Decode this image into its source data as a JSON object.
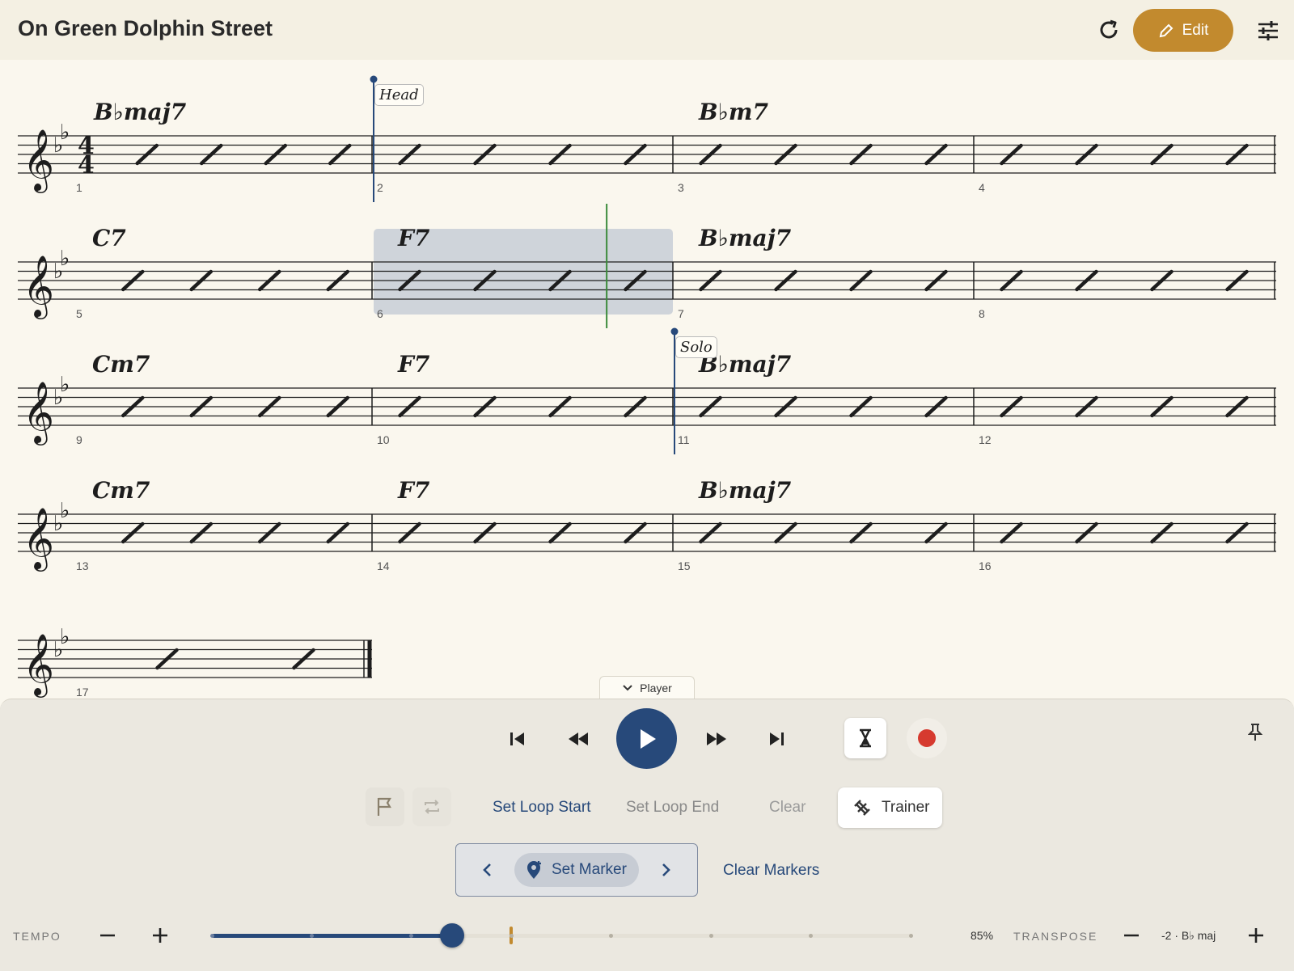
{
  "header": {
    "title": "On Green Dolphin Street",
    "edit_label": "Edit",
    "icons": [
      "refresh-icon",
      "pencil-icon",
      "sliders-icon"
    ]
  },
  "score": {
    "time_signature": "4/4",
    "key": "Bb major",
    "rows": [
      {
        "measures": [
          {
            "number": "1",
            "chord": "Bbmaj7",
            "beats": 4
          },
          {
            "number": "2",
            "chord": "",
            "beats": 4,
            "marker": "Head"
          },
          {
            "number": "3",
            "chord": "Bbm7",
            "beats": 4
          },
          {
            "number": "4",
            "chord": "",
            "beats": 4
          }
        ]
      },
      {
        "measures": [
          {
            "number": "5",
            "chord": "C7",
            "beats": 4
          },
          {
            "number": "6",
            "chord": "F7",
            "beats": 4,
            "loop": true
          },
          {
            "number": "7",
            "chord": "Bbmaj7",
            "beats": 4
          },
          {
            "number": "8",
            "chord": "",
            "beats": 4
          }
        ]
      },
      {
        "measures": [
          {
            "number": "9",
            "chord": "Cm7",
            "beats": 4
          },
          {
            "number": "10",
            "chord": "F7",
            "beats": 4
          },
          {
            "number": "11",
            "chord": "Bbmaj7",
            "beats": 4,
            "marker": "Solo"
          },
          {
            "number": "12",
            "chord": "",
            "beats": 4
          }
        ]
      },
      {
        "measures": [
          {
            "number": "13",
            "chord": "Cm7",
            "beats": 4
          },
          {
            "number": "14",
            "chord": "F7",
            "beats": 4
          },
          {
            "number": "15",
            "chord": "Bbmaj7",
            "beats": 4
          },
          {
            "number": "16",
            "chord": "",
            "beats": 4
          }
        ]
      },
      {
        "measures": [
          {
            "number": "17",
            "chord": "",
            "beats": 2,
            "final": true
          }
        ]
      }
    ],
    "playhead_measure": "6",
    "playhead_fraction": 0.78,
    "colors": {
      "staff": "#1d1d1d",
      "loop_region": "#cfd4da",
      "playhead": "#3a8a3a",
      "marker": "#27497a"
    }
  },
  "player": {
    "tab_label": "Player",
    "transport": [
      "skip-to-start-icon",
      "rewind-icon",
      "play-icon",
      "fast-forward-icon",
      "skip-to-end-icon",
      "hourglass-icon",
      "record-icon",
      "pin-icon"
    ],
    "loop_row": {
      "flag_icon": "flag-icon",
      "loop_icon": "loop-icon",
      "set_loop_start": "Set Loop Start",
      "set_loop_end": "Set Loop End",
      "clear": "Clear",
      "trainer": "Trainer"
    },
    "markers_row": {
      "set_marker": "Set Marker",
      "clear_markers": "Clear Markers"
    },
    "tempo": {
      "label": "TEMPO",
      "value_text": "85%",
      "slider_fraction": 0.344,
      "reference_fraction": 0.428
    },
    "transpose": {
      "label": "TRANSPOSE",
      "value_text": "-2 · B♭ maj"
    },
    "colors": {
      "accent": "#27497a",
      "record": "#d63a2f",
      "edit": "#c28a2e"
    }
  }
}
